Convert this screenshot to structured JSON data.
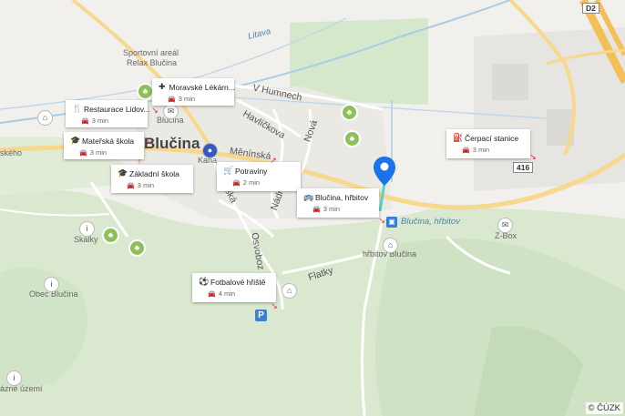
{
  "map": {
    "town": "Blučina",
    "streets": {
      "v_humnech": "V Humnech",
      "havlickova": "Havlíčkova",
      "nova": "Nová",
      "meninska": "Měnínská",
      "kana": "Kaňa",
      "skolska": "Školská",
      "nadrazni": "Nádr",
      "osvobozeni": "Osvoboz",
      "flatky": "Flatky",
      "skeho": "ského",
      "road_d2": "D2",
      "road_416": "416"
    },
    "places": {
      "sportovni_areal": "Sportovní areál",
      "relax": "Relax Blučina",
      "blucina_small": "Blučina",
      "skalky": "Skalky",
      "obec_blucina": "Obec Blučina",
      "hrbitov": "hřbitov Blučina",
      "zbox": "Z-Box",
      "uzemi": "ázné území"
    },
    "waters": {
      "litava": "Litava",
      "stop": "Blučina, hřbitov"
    },
    "copyright": "© ČÚZK"
  },
  "cards": {
    "restaurace": {
      "title": "Restaurace Lidov...",
      "time": "3 min",
      "icon": "fork-knife-icon"
    },
    "lekarna": {
      "title": "Moravské Lékárn...",
      "time": "3 min",
      "icon": "pharmacy-cross-icon"
    },
    "materska": {
      "title": "Mateřská škola",
      "time": "3 min",
      "icon": "school-cap-icon"
    },
    "zakladni": {
      "title": "Základní škola",
      "time": "3 min",
      "icon": "school-cap-icon"
    },
    "potraviny": {
      "title": "Potraviny",
      "time": "2 min",
      "icon": "cart-icon"
    },
    "bus": {
      "title": "Blučina, hřbitov",
      "time": "3 min",
      "icon": "bus-icon"
    },
    "fotbal": {
      "title": "Fotbalové hřiště",
      "time": "4 min",
      "icon": "football-icon"
    },
    "cerpaci": {
      "title": "Čerpací stanice",
      "time": "3 min",
      "icon": "fuel-pump-icon"
    }
  },
  "colors": {
    "pin": "#1a73e8",
    "arrow": "#d33333",
    "green_area": "#d8e8cf",
    "road": "#ffffff",
    "major_road": "#f6d27a"
  }
}
